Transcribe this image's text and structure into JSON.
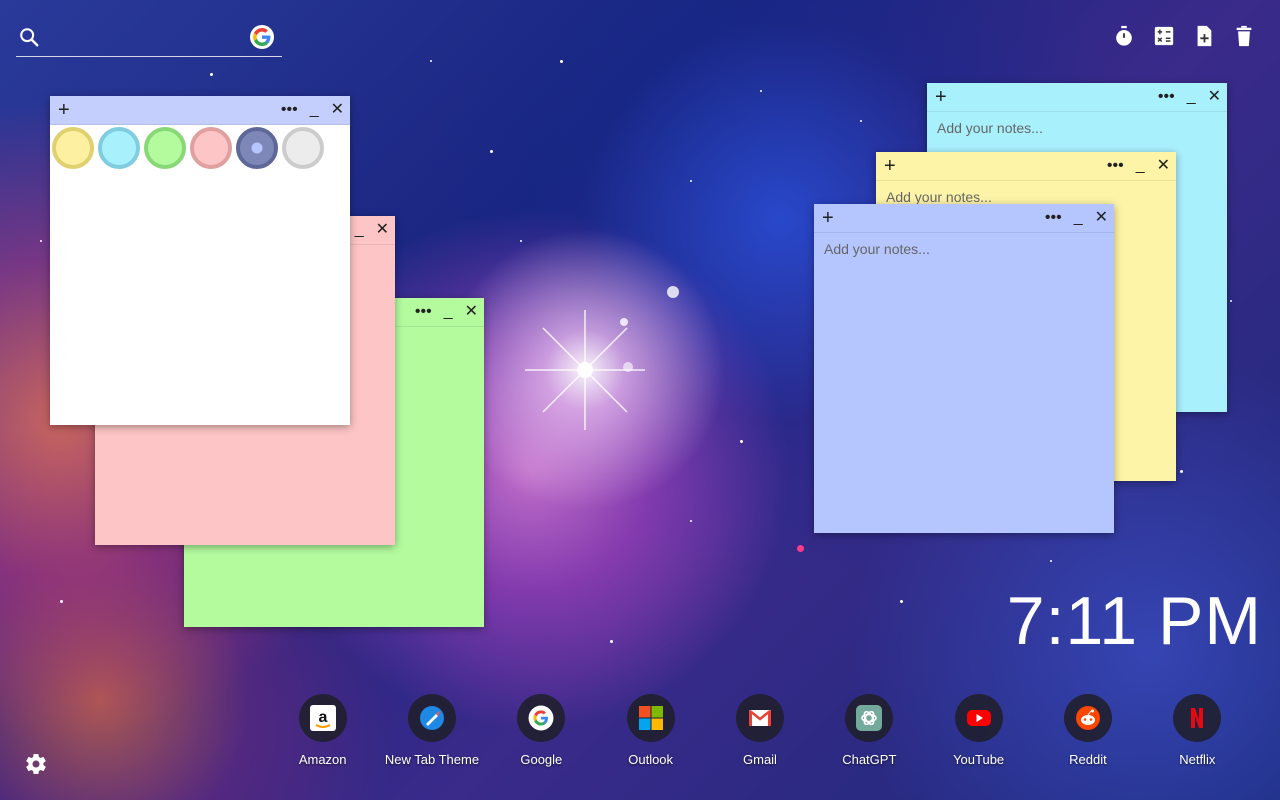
{
  "search": {
    "placeholder": "",
    "engine_icon": "google-icon"
  },
  "toolbar": {
    "icons": [
      "timer-icon",
      "calculator-icon",
      "new-note-icon",
      "trash-icon"
    ]
  },
  "notes": [
    {
      "id": "white",
      "color": "#ffffff",
      "value": "",
      "placeholder": ""
    },
    {
      "id": "pink",
      "color": "#fdc5c5",
      "value": "",
      "placeholder": ""
    },
    {
      "id": "green",
      "color": "#b4fb9e",
      "value": "",
      "placeholder": ""
    },
    {
      "id": "cyan",
      "color": "#a9f0fd",
      "value": "",
      "placeholder": "Add your notes..."
    },
    {
      "id": "yellow",
      "color": "#fdf4a8",
      "value": "",
      "placeholder": "Add your notes..."
    },
    {
      "id": "periwinkle",
      "color": "#b5c5fd",
      "value": "",
      "placeholder": "Add your notes..."
    }
  ],
  "note_controls": {
    "add": "+",
    "more": "•••",
    "minimize": "_",
    "close": "✕"
  },
  "palette": [
    {
      "name": "yellow",
      "fill": "#fdf0a0",
      "ring": "#e0d070"
    },
    {
      "name": "cyan",
      "fill": "#a9f0fd",
      "ring": "#80cce0"
    },
    {
      "name": "green",
      "fill": "#b4fb9e",
      "ring": "#88d878"
    },
    {
      "name": "pink",
      "fill": "#fdc5c5",
      "ring": "#e0a0a0"
    },
    {
      "name": "periwinkle",
      "fill": "#7e88b8",
      "ring": "#5e6898",
      "selected": true
    },
    {
      "name": "white",
      "fill": "#ececec",
      "ring": "#cccccc"
    }
  ],
  "clock": {
    "time": "7:11 PM"
  },
  "dock": [
    {
      "label": "Amazon",
      "icon": "amazon-icon"
    },
    {
      "label": "New Tab Theme",
      "icon": "new-tab-theme-icon"
    },
    {
      "label": "Google",
      "icon": "google-icon"
    },
    {
      "label": "Outlook",
      "icon": "outlook-icon"
    },
    {
      "label": "Gmail",
      "icon": "gmail-icon"
    },
    {
      "label": "ChatGPT",
      "icon": "chatgpt-icon"
    },
    {
      "label": "YouTube",
      "icon": "youtube-icon"
    },
    {
      "label": "Reddit",
      "icon": "reddit-icon"
    },
    {
      "label": "Netflix",
      "icon": "netflix-icon"
    }
  ],
  "settings": {
    "icon": "gear-icon"
  }
}
